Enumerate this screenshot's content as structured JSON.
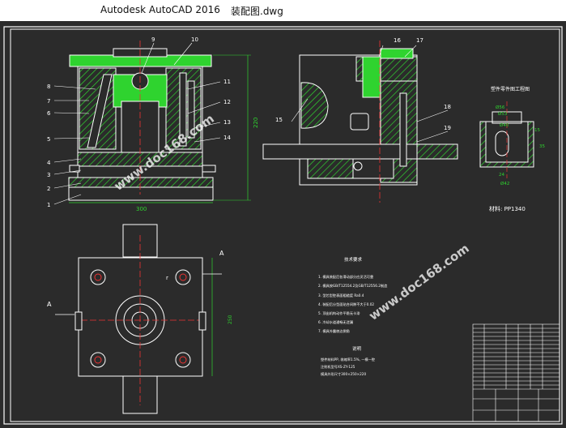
{
  "window": {
    "app_title": "Autodesk AutoCAD 2016",
    "file_name": "装配图.dwg"
  },
  "drawing": {
    "part_labels_left": [
      "8",
      "7",
      "6",
      "5",
      "4",
      "3",
      "2",
      "1"
    ],
    "part_labels_top": [
      "9",
      "10"
    ],
    "part_labels_right": [
      "11",
      "12",
      "13",
      "14"
    ],
    "side_labels_top": [
      "16",
      "17"
    ],
    "side_labels": [
      "15",
      "18",
      "19"
    ],
    "dim_width": "300",
    "dim_height": "220",
    "dim_plan": "250",
    "section_mark": "A",
    "gate_mark": "r",
    "part_title": "塑件零件图工程图",
    "material": "材料: PP1340",
    "part_dims": [
      "Ø56",
      "Ø53",
      "Ø40",
      "15",
      "35",
      "24",
      "Ø42"
    ],
    "watermark": "www.doc168.com",
    "tech_title": "技术要求",
    "tech_lines": [
      "1. 模具装配后各滑动部分应灵活可靠",
      "2. 模具按GB/T12554.2及GB/T12556.2制造",
      "3. 型芯型腔表面粗糙度 Ra0.4",
      "4. 装配后分型面贴合间隙不大于0.02",
      "5. 顶出机构动作平稳无卡滞",
      "6. 冷却水道通畅无泄漏",
      "7. 模具外露棱边倒角"
    ],
    "note_title": "说明",
    "note_lines": [
      "塑件材料PP, 收缩率1.5%, 一模一腔",
      "注射机型号XS-ZY-125",
      "模具外形尺寸300×250×220"
    ]
  }
}
